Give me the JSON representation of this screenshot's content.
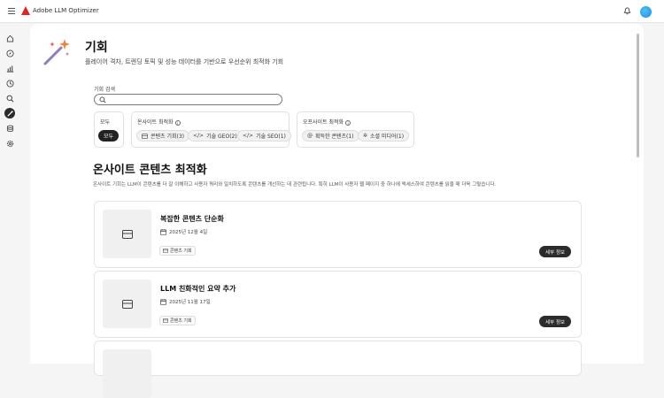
{
  "app": {
    "title": "Adobe LLM Optimizer"
  },
  "header": {
    "title": "기회",
    "subtitle": "플레이어 격차, 트렌딩 토픽 및 성능 데이터를 기반으로 우선순위 최적화 기회"
  },
  "search": {
    "label": "기회 검색",
    "value": "",
    "placeholder": ""
  },
  "filters": {
    "all": {
      "label": "모두",
      "chips": [
        {
          "label": "모두",
          "selected": true
        }
      ]
    },
    "onsite": {
      "label": "온사이트 최적화",
      "chips": [
        {
          "icon": "card-icon",
          "label": "콘텐츠 기회(3)"
        },
        {
          "icon": "code-icon",
          "label": "기술 GEO(2)"
        },
        {
          "icon": "code-icon",
          "label": "기술 SEO(1)"
        }
      ]
    },
    "offsite": {
      "label": "오프사이트 최적화",
      "chips": [
        {
          "icon": "at-icon",
          "label": "획득한 콘텐츠(1)"
        },
        {
          "icon": "social-icon",
          "label": "소셜 미디어(1)"
        }
      ]
    }
  },
  "section": {
    "title": "온사이트 콘텐츠 최적화",
    "description": "온사이트 기회는 LLM이 콘텐츠를 더 잘 이해하고 사용자 쿼리와 일치하도록 콘텐츠를 개선하는 데 관련됩니다. 특히 LLM이 사용자 웹 페이지 중 하나에 액세스하여 콘텐츠를 읽을 때 더욱 그렇습니다."
  },
  "cards": [
    {
      "title": "복잡한 콘텐츠 단순화",
      "date": "2025년 12월 4일",
      "tag": "콘텐츠 기회",
      "button": "세부 정보"
    },
    {
      "title": "LLM 친화적인 요약 추가",
      "date": "2025년 11월 17일",
      "tag": "콘텐츠 기회",
      "button": "세부 정보"
    }
  ],
  "colors": {
    "brand": "#e1251b",
    "dark": "#2c2c2c",
    "avatar": "#1e88e5"
  }
}
